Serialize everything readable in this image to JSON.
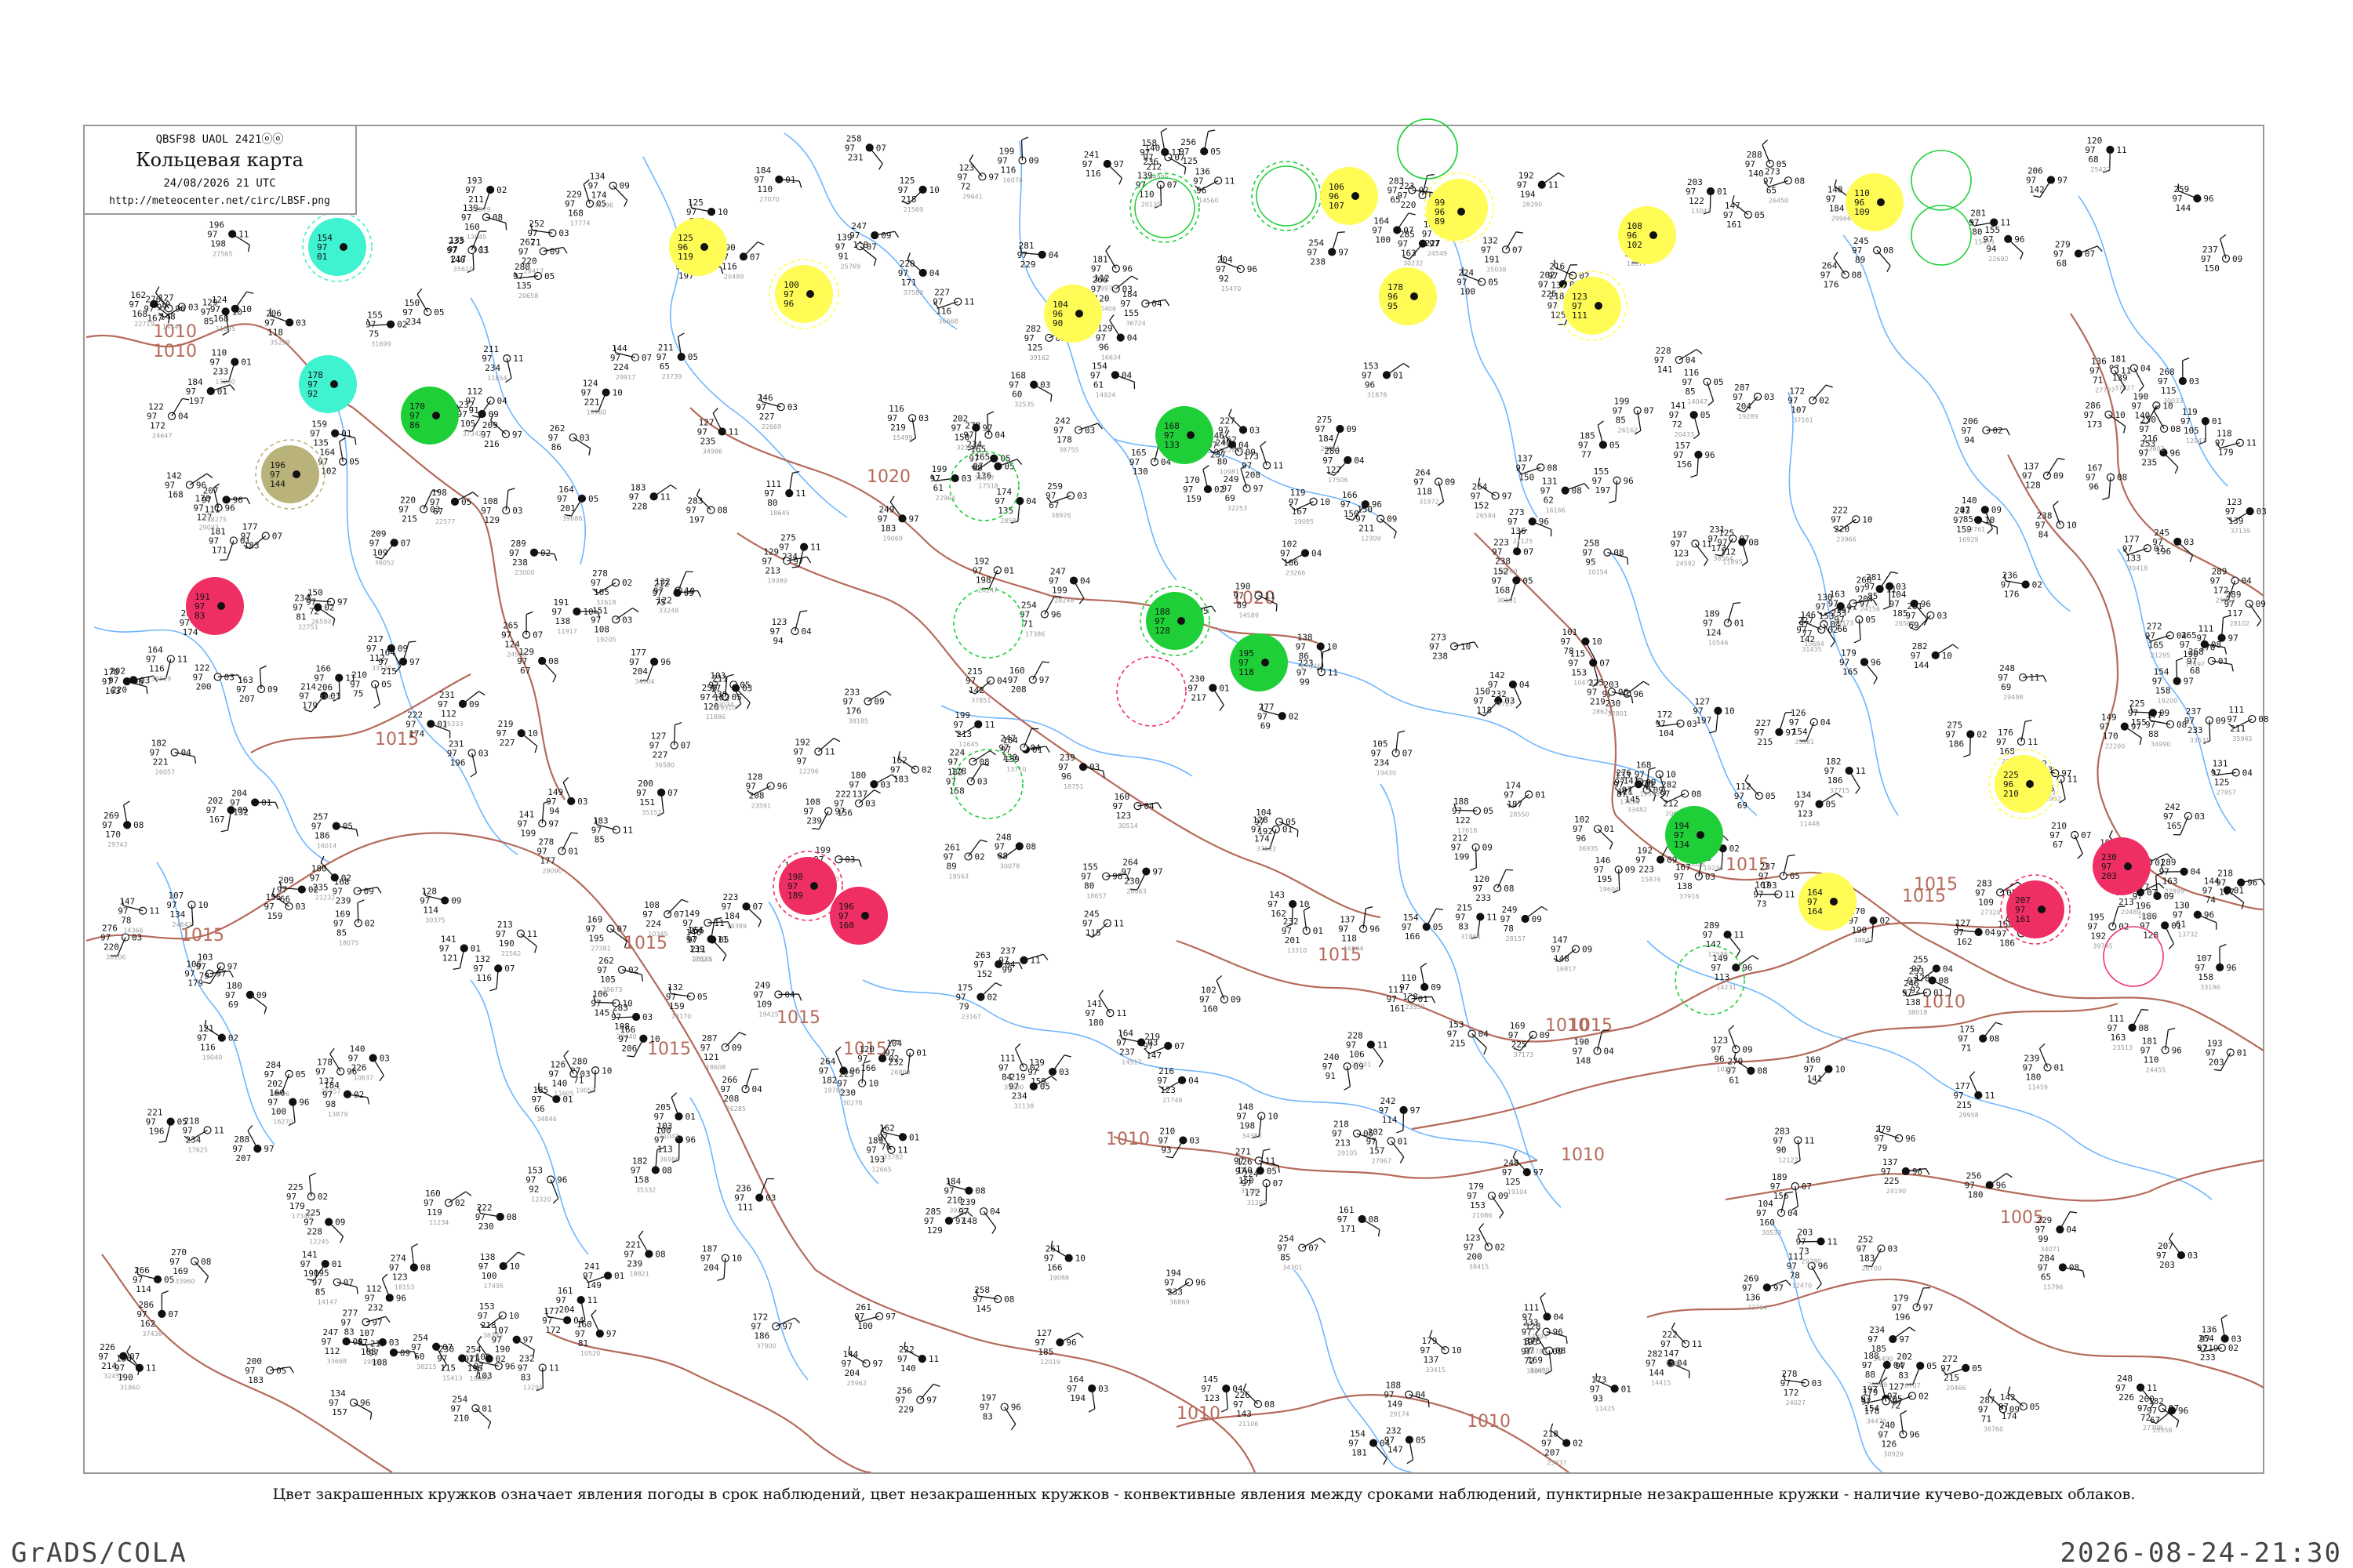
{
  "header": {
    "code": "QBSF98  UAOL  2421ⓞⓞ",
    "title": "Кольцевая карта",
    "date": "24/08/2026 21 UTC",
    "url": "http://meteocenter.net/circ/LBSF.png"
  },
  "caption": "Цвет закрашенных кружков означает явления погоды в срок наблюдений, цвет незакрашенных кружков - конвективные явления между сроками наблюдений, пунктирные незакрашенные кружки - наличие кучево-дождевых облаков.",
  "footer": {
    "left": "GrADS/COLA",
    "right": "2026-08-24-21:30"
  },
  "colors": {
    "rivers": "#6fb6ff",
    "isobars": "#b56a5a",
    "frame": "#999999",
    "red": "#ef2f64",
    "green": "#1fcf38",
    "yellow": "#fffc55",
    "cyan": "#3ff2d0",
    "olive": "#b9b27a"
  },
  "isobar_labels": [
    {
      "text": "1010"
    },
    {
      "text": "1010"
    },
    {
      "text": "1015"
    },
    {
      "text": "1015"
    },
    {
      "text": "1015"
    },
    {
      "text": "1015"
    },
    {
      "text": "1015"
    },
    {
      "text": "1015"
    },
    {
      "text": "1020"
    },
    {
      "text": "1020"
    },
    {
      "text": "1015"
    },
    {
      "text": "1015"
    },
    {
      "text": "1015"
    },
    {
      "text": "1015"
    },
    {
      "text": "1015"
    },
    {
      "text": "1010"
    },
    {
      "text": "1010"
    },
    {
      "text": "1010"
    },
    {
      "text": "1010"
    },
    {
      "text": "1010"
    },
    {
      "text": "1005"
    },
    {
      "text": "1010"
    }
  ],
  "highlighted_stations": [
    {
      "color": "cyan",
      "values": [
        "154",
        "97",
        "01"
      ]
    },
    {
      "color": "cyan",
      "values": [
        "178",
        "97",
        "92"
      ]
    },
    {
      "color": "green",
      "values": [
        "170",
        "97",
        "86"
      ]
    },
    {
      "color": "olive",
      "values": [
        "196",
        "97",
        "144"
      ]
    },
    {
      "color": "red",
      "values": [
        "191",
        "97",
        "83"
      ]
    },
    {
      "color": "yellow",
      "values": [
        "125",
        "96",
        "119"
      ]
    },
    {
      "color": "yellow",
      "values": [
        "100",
        "97",
        "96"
      ]
    },
    {
      "color": "yellow",
      "values": [
        "104",
        "96",
        "90"
      ]
    },
    {
      "color": "green",
      "values": [
        "168",
        "97",
        "133"
      ]
    },
    {
      "color": "green",
      "values": [
        "188",
        "97",
        "128"
      ]
    },
    {
      "color": "green",
      "values": [
        "195",
        "97",
        "118"
      ]
    },
    {
      "color": "yellow",
      "values": [
        "106",
        "96",
        "107"
      ]
    },
    {
      "color": "yellow",
      "values": [
        "98",
        "96",
        "103"
      ]
    },
    {
      "color": "yellow",
      "values": [
        "99",
        "96",
        "89"
      ]
    },
    {
      "color": "yellow",
      "values": [
        "178",
        "96",
        "95"
      ]
    },
    {
      "color": "yellow",
      "values": [
        "123",
        "97",
        "111"
      ]
    },
    {
      "color": "yellow",
      "values": [
        "108",
        "96",
        "102"
      ]
    },
    {
      "color": "yellow",
      "values": [
        "110",
        "96",
        "109"
      ]
    },
    {
      "color": "yellow",
      "values": [
        "225",
        "96",
        "210"
      ]
    },
    {
      "color": "yellow",
      "values": [
        "164",
        "97",
        "164"
      ]
    },
    {
      "color": "green",
      "values": [
        "194",
        "97",
        "134"
      ]
    },
    {
      "color": "red",
      "values": [
        "198",
        "97",
        "189"
      ]
    },
    {
      "color": "red",
      "values": [
        "196",
        "97",
        "160"
      ]
    },
    {
      "color": "red",
      "values": [
        "230",
        "97",
        "203"
      ]
    },
    {
      "color": "red",
      "values": [
        "207",
        "97",
        "161"
      ]
    }
  ],
  "outline_circles": [
    {
      "style": "solid-green"
    },
    {
      "style": "dashed-green"
    },
    {
      "style": "solid-green"
    },
    {
      "style": "dashed-green"
    },
    {
      "style": "solid-green"
    },
    {
      "style": "solid-green"
    },
    {
      "style": "dashed-green"
    },
    {
      "style": "dashed-green"
    },
    {
      "style": "dashed-red"
    },
    {
      "style": "dashed-green"
    },
    {
      "style": "solid-green"
    },
    {
      "style": "solid-green"
    },
    {
      "style": "solid-red"
    },
    {
      "style": "dashed-green"
    }
  ]
}
